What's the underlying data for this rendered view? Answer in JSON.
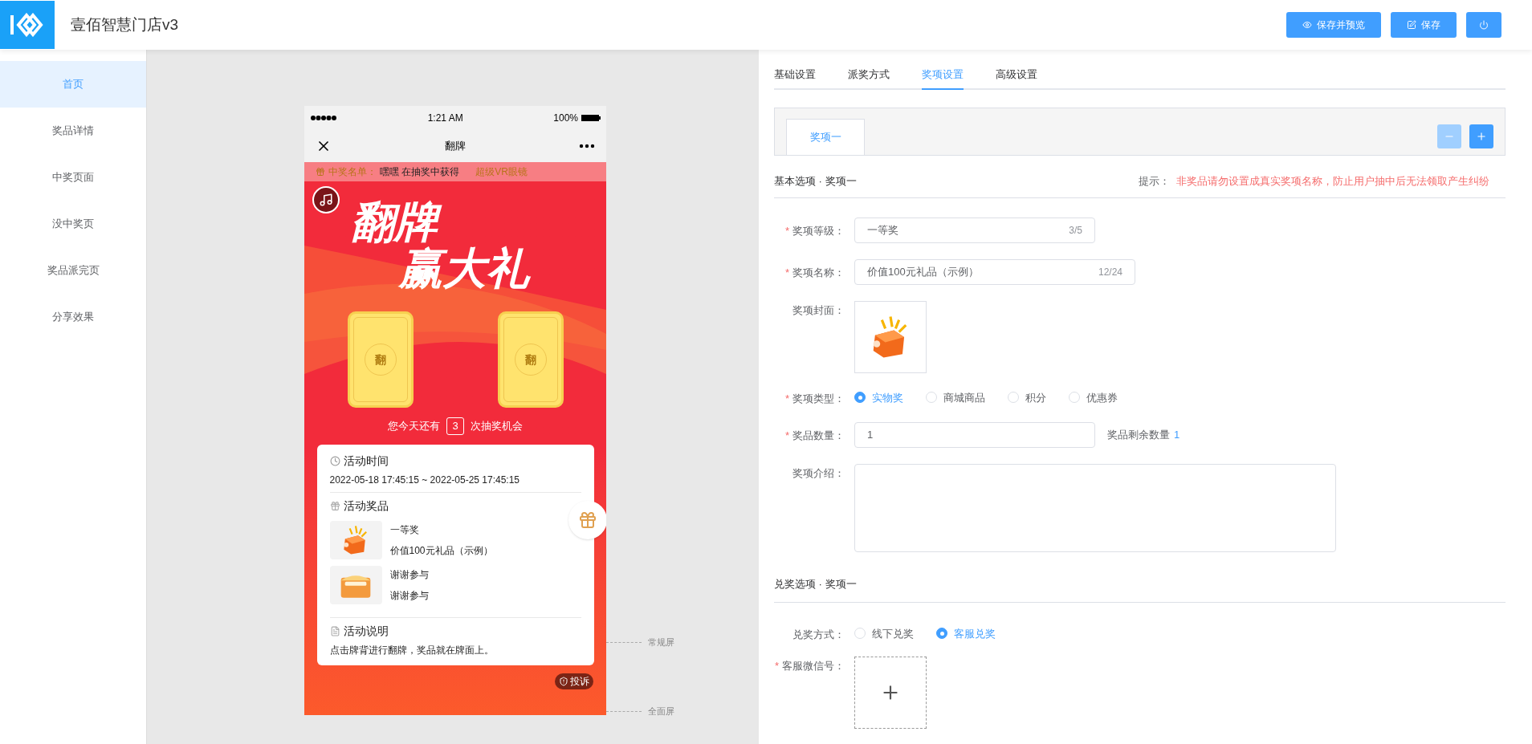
{
  "header": {
    "title": "壹佰智慧门店v3",
    "buttons": [
      {
        "kind": "preview",
        "label": "保存并预览"
      },
      {
        "kind": "save",
        "label": "保存"
      },
      {
        "kind": "power"
      }
    ]
  },
  "sidebar": {
    "items": [
      {
        "label": "首页",
        "selected": true
      },
      {
        "label": "奖品详情",
        "selected": false
      },
      {
        "label": "中奖页面",
        "selected": false
      },
      {
        "label": "没中奖页",
        "selected": false
      },
      {
        "label": "奖品派完页",
        "selected": false
      },
      {
        "label": "分享效果",
        "selected": false
      }
    ]
  },
  "phone": {
    "status": {
      "time": "1:21 AM",
      "battery": "100%"
    },
    "nav_title": "翻牌",
    "winners": {
      "label": "中奖名单：",
      "name": "嘿嘿 在抽奖中获得",
      "prize": "超级VR眼镜"
    },
    "hero": [
      "翻牌",
      "赢大礼"
    ],
    "cards": [
      "翻",
      "翻"
    ],
    "chances": {
      "before": "您今天还有",
      "count": "3",
      "after": "次抽奖机会"
    },
    "time_section": {
      "title": "活动时间",
      "range": "2022-05-18 17:45:15 ~ 2022-05-25 17:45:15"
    },
    "prize_section": {
      "title": "活动奖品",
      "prizes": [
        {
          "kind": "gift",
          "level": "一等奖",
          "name": "价值100元礼品（示例）"
        },
        {
          "kind": "envelope",
          "level": "谢谢参与",
          "name": "谢谢参与"
        }
      ]
    },
    "rules_section": {
      "title": "活动说明",
      "text": "点击牌背进行翻牌，奖品就在牌面上。"
    },
    "complaint": "投诉"
  },
  "screen_marks": [
    "常规屏",
    "全面屏"
  ],
  "settings": {
    "tabs": [
      {
        "label": "基础设置",
        "selected": false
      },
      {
        "label": "派奖方式",
        "selected": false
      },
      {
        "label": "奖项设置",
        "selected": true
      },
      {
        "label": "高级设置",
        "selected": false
      }
    ],
    "prize_tabs": [
      {
        "label": "奖项一",
        "selected": true
      }
    ],
    "basic": {
      "title": "基本选项 · 奖项一",
      "hint_label": "提示：",
      "hint": "非奖品请勿设置成真实奖项名称，防止用户抽中后无法领取产生纠纷"
    },
    "fields": [
      {
        "kind": "text",
        "required_mark": "*",
        "label": "奖项等级：",
        "value": "一等奖",
        "counter": "3/5"
      },
      {
        "kind": "text",
        "required_mark": "*",
        "label": "奖项名称：",
        "value": "价值100元礼品（示例）",
        "counter": "12/24"
      },
      {
        "kind": "image",
        "label": "奖项封面："
      },
      {
        "kind": "radio",
        "required_mark": "*",
        "label": "奖项类型：",
        "options": [
          {
            "label": "实物奖",
            "selected": true
          },
          {
            "label": "商城商品",
            "selected": false
          },
          {
            "label": "积分",
            "selected": false
          },
          {
            "label": "优惠券",
            "selected": false
          }
        ]
      },
      {
        "kind": "number",
        "required_mark": "*",
        "label": "奖品数量：",
        "value": "1",
        "note": "奖品剩余数量",
        "note_value": "1"
      },
      {
        "kind": "textarea",
        "label": "奖项介绍："
      }
    ],
    "redeem": {
      "title": "兑奖选项 · 奖项一"
    },
    "redeem_fields": [
      {
        "kind": "radio",
        "label": "兑奖方式：",
        "options": [
          {
            "label": "线下兑奖",
            "selected": false
          },
          {
            "label": "客服兑奖",
            "selected": true
          }
        ]
      },
      {
        "kind": "upload",
        "required_mark": "*",
        "label": "客服微信号："
      }
    ]
  }
}
